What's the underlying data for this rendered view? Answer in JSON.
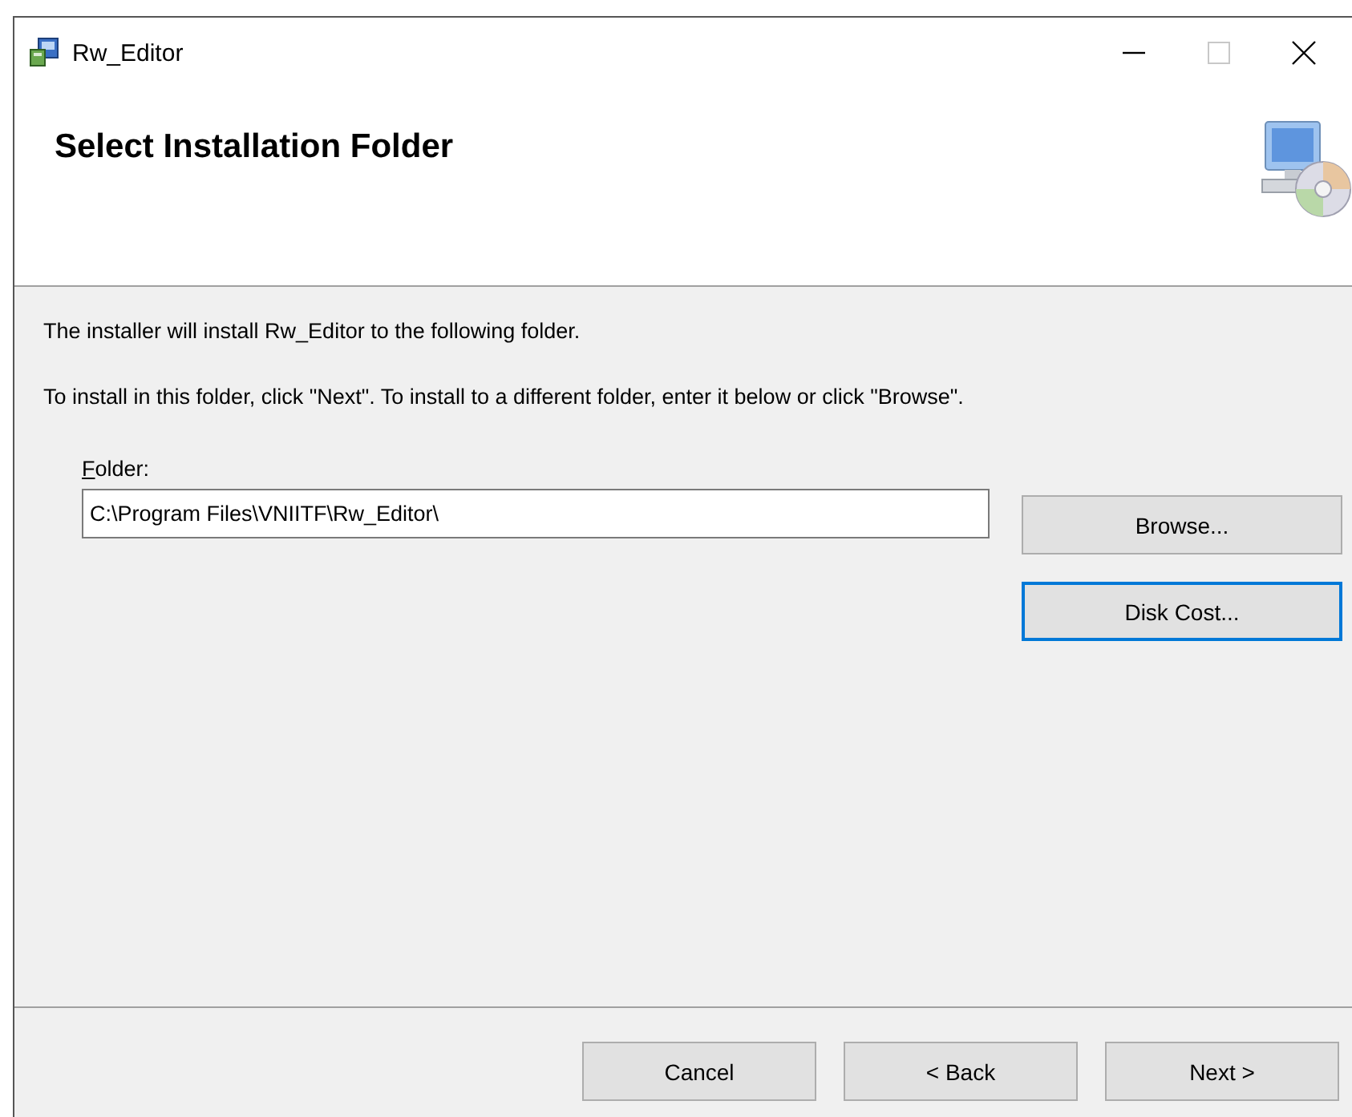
{
  "window": {
    "title": "Rw_Editor"
  },
  "header": {
    "title": "Select Installation Folder"
  },
  "intro": [
    "The installer will install Rw_Editor to the following folder.",
    "To install in this folder, click \"Next\". To install to a different folder, enter it below or click \"Browse\"."
  ],
  "folder": {
    "label": "Folder:",
    "value": "C:\\Program Files\\VNIITF\\Rw_Editor\\"
  },
  "side_buttons": [
    {
      "label": "Browse...",
      "focused": false
    },
    {
      "label": "Disk Cost...",
      "focused": true
    }
  ],
  "footer_buttons": [
    {
      "label": "Cancel",
      "focused": false
    },
    {
      "label": "< Back",
      "focused": false
    },
    {
      "label": "Next >",
      "focused": false
    }
  ]
}
